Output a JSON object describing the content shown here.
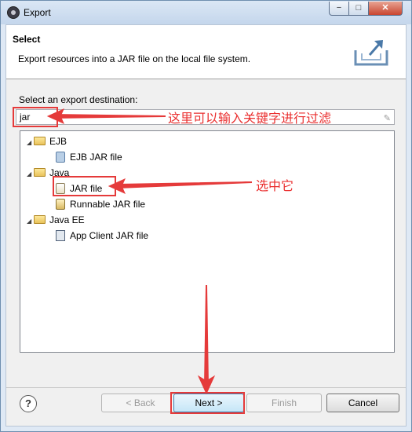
{
  "window": {
    "title": "Export",
    "controls": [
      "−",
      "□",
      "✕"
    ]
  },
  "header": {
    "title": "Select",
    "description": "Export resources into a JAR file on the local file system.",
    "icon": "export-icon"
  },
  "filter": {
    "label": "Select an export destination:",
    "value": "jar"
  },
  "tree": [
    {
      "label": "EJB",
      "kind": "folder",
      "expanded": true,
      "children": [
        {
          "label": "EJB JAR file",
          "icon": "ejb-jar-icon"
        }
      ]
    },
    {
      "label": "Java",
      "kind": "folder",
      "expanded": true,
      "children": [
        {
          "label": "JAR file",
          "icon": "jar-file-icon"
        },
        {
          "label": "Runnable JAR file",
          "icon": "runnable-jar-icon"
        }
      ]
    },
    {
      "label": "Java EE",
      "kind": "folder",
      "expanded": true,
      "children": [
        {
          "label": "App Client JAR file",
          "icon": "app-client-jar-icon"
        }
      ]
    }
  ],
  "annotations": {
    "filter_note": "这里可以输入关键字进行过滤",
    "select_note": "选中它"
  },
  "buttons": {
    "help": "?",
    "back": "< Back",
    "next": "Next >",
    "finish": "Finish",
    "cancel": "Cancel"
  },
  "colors": {
    "annotation_red": "#e53a3a"
  }
}
